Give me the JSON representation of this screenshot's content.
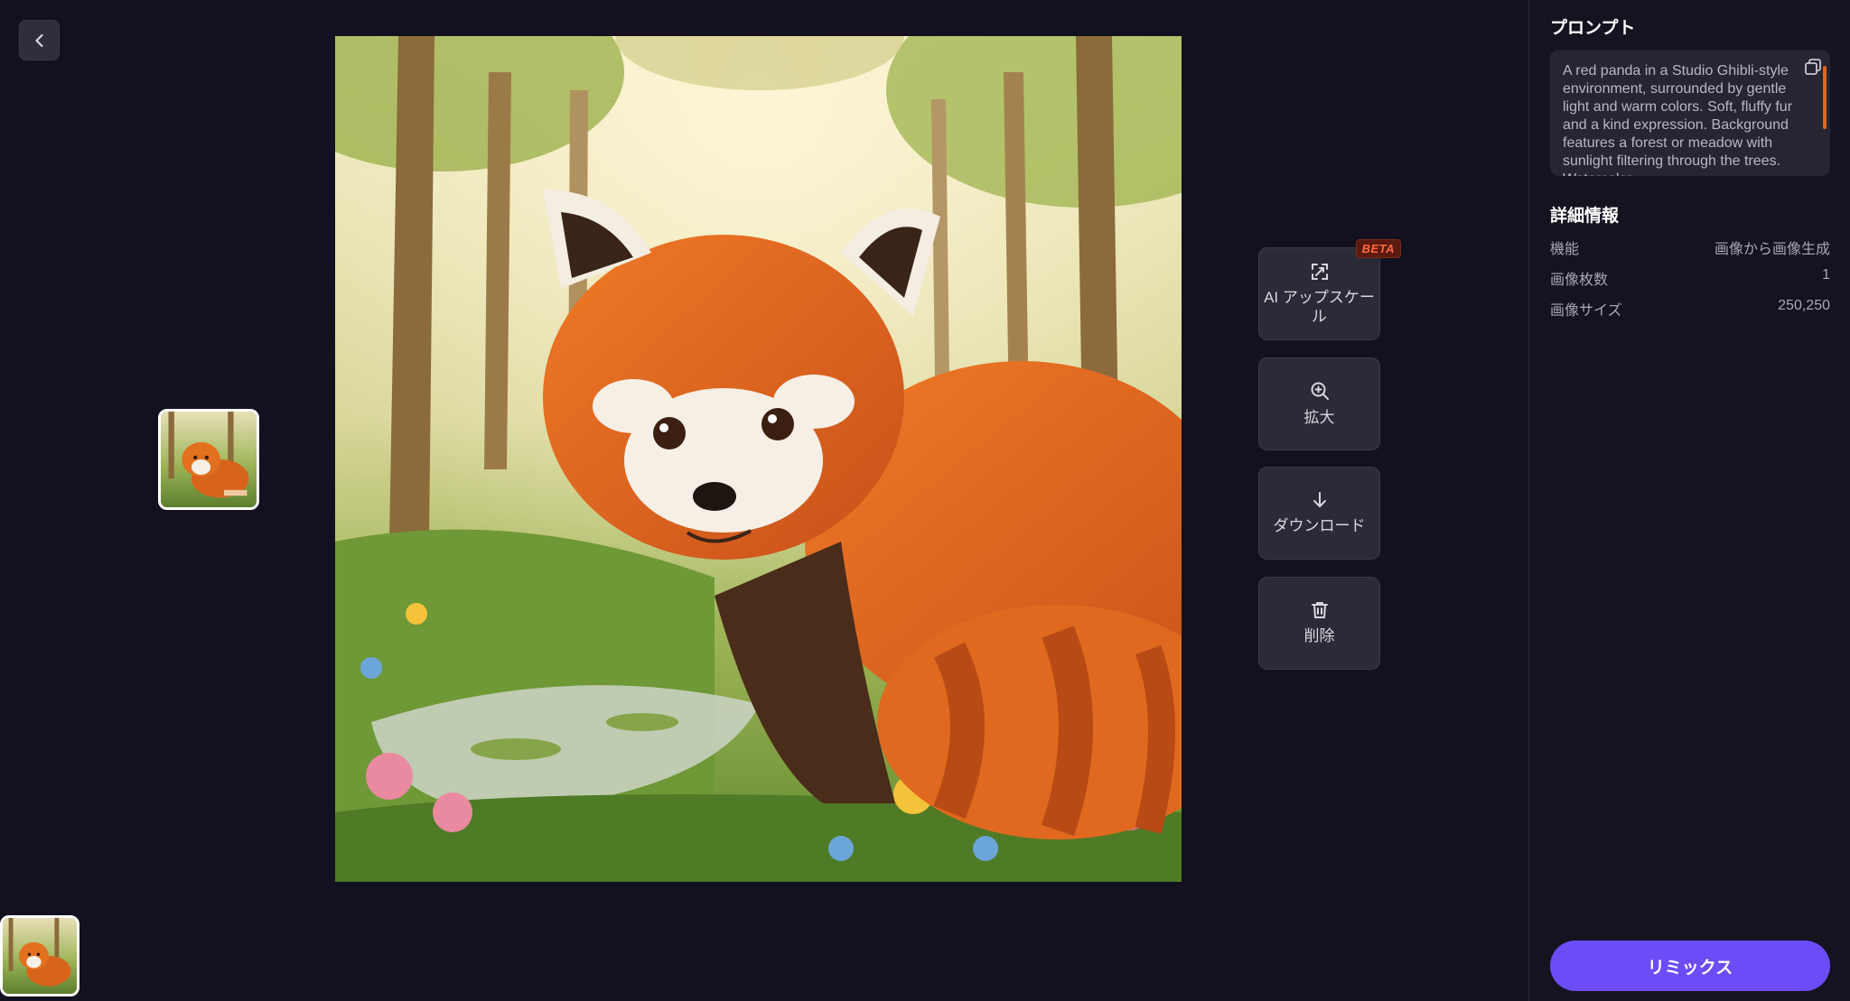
{
  "actions": {
    "upscale_label": "AI アップスケール",
    "beta": "BETA",
    "zoom_label": "拡大",
    "download_label": "ダウンロード",
    "delete_label": "削除"
  },
  "panel": {
    "prompt_heading": "プロンプト",
    "prompt_text": "A red panda in a Studio Ghibli-style environment, surrounded by gentle light and warm colors. Soft, fluffy fur and a kind expression. Background features a forest or meadow with sunlight filtering through the trees. Watercolor",
    "details_heading": "詳細情報",
    "details": [
      {
        "key": "機能",
        "value": "画像から画像生成"
      },
      {
        "key": "画像枚数",
        "value": "1"
      },
      {
        "key": "画像サイズ",
        "value": "250,250"
      }
    ],
    "remix_label": "リミックス"
  },
  "colors": {
    "background": "#13111f",
    "accent": "#6b4cf6",
    "beta": "#ff6a3d"
  },
  "icons": {
    "back": "chevron-left-icon",
    "upscale": "upscale-icon",
    "zoom": "zoom-in-icon",
    "download": "download-arrow-icon",
    "delete": "trash-icon",
    "copy": "copy-icon"
  }
}
